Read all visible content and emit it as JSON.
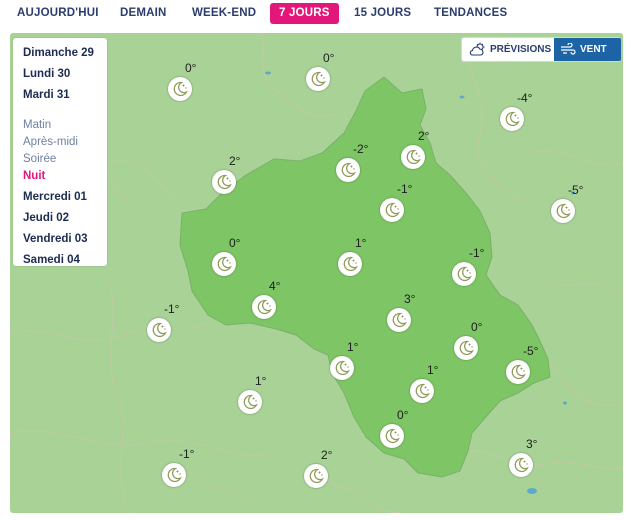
{
  "tabs": [
    {
      "label": "AUJOURD'HUI",
      "active": false
    },
    {
      "label": "DEMAIN",
      "active": false
    },
    {
      "label": "WEEK-END",
      "active": false
    },
    {
      "label": "7 JOURS",
      "active": true
    },
    {
      "label": "15 JOURS",
      "active": false
    },
    {
      "label": "TENDANCES",
      "active": false
    }
  ],
  "colors": {
    "accent": "#e3177a",
    "toggle_active": "#1c64a6",
    "department": "#7ec665",
    "map_bg": "#a9d396"
  },
  "day_panel": {
    "days_before": [
      "Dimanche 29",
      "Lundi 30",
      "Mardi 31"
    ],
    "periods": [
      "Matin",
      "Après-midi",
      "Soirée",
      "Nuit"
    ],
    "active_period": "Nuit",
    "days_after": [
      "Mercredi 01",
      "Jeudi 02",
      "Vendredi 03",
      "Samedi 04"
    ]
  },
  "toggle": {
    "previsions": "PRÉVISIONS",
    "vent": "VENT",
    "active": "VENT",
    "previsions_icon": "cloud-sun-icon",
    "vent_icon": "wind-icon"
  },
  "stations": [
    {
      "temp": "0°",
      "icon": "moon-stars-icon"
    },
    {
      "temp": "0°",
      "icon": "moon-stars-icon"
    },
    {
      "temp": "-4°",
      "icon": "moon-stars-icon"
    },
    {
      "temp": "2°",
      "icon": "moon-stars-icon"
    },
    {
      "temp": "-2°",
      "icon": "moon-stars-icon"
    },
    {
      "temp": "2°",
      "icon": "moon-stars-icon"
    },
    {
      "temp": "-1°",
      "icon": "moon-stars-icon"
    },
    {
      "temp": "-5°",
      "icon": "moon-stars-icon"
    },
    {
      "temp": "0°",
      "icon": "moon-stars-icon"
    },
    {
      "temp": "1°",
      "icon": "moon-stars-icon"
    },
    {
      "temp": "-1°",
      "icon": "moon-stars-icon"
    },
    {
      "temp": "4°",
      "icon": "moon-stars-icon"
    },
    {
      "temp": "3°",
      "icon": "moon-stars-icon"
    },
    {
      "temp": "-1°",
      "icon": "moon-stars-icon"
    },
    {
      "temp": "0°",
      "icon": "moon-stars-icon"
    },
    {
      "temp": "1°",
      "icon": "moon-stars-icon"
    },
    {
      "temp": "-5°",
      "icon": "moon-stars-icon"
    },
    {
      "temp": "1°",
      "icon": "moon-stars-icon"
    },
    {
      "temp": "1°",
      "icon": "moon-stars-icon"
    },
    {
      "temp": "0°",
      "icon": "moon-stars-icon"
    },
    {
      "temp": "3°",
      "icon": "moon-stars-icon"
    },
    {
      "temp": "-1°",
      "icon": "moon-stars-icon"
    },
    {
      "temp": "2°",
      "icon": "moon-stars-icon"
    }
  ]
}
